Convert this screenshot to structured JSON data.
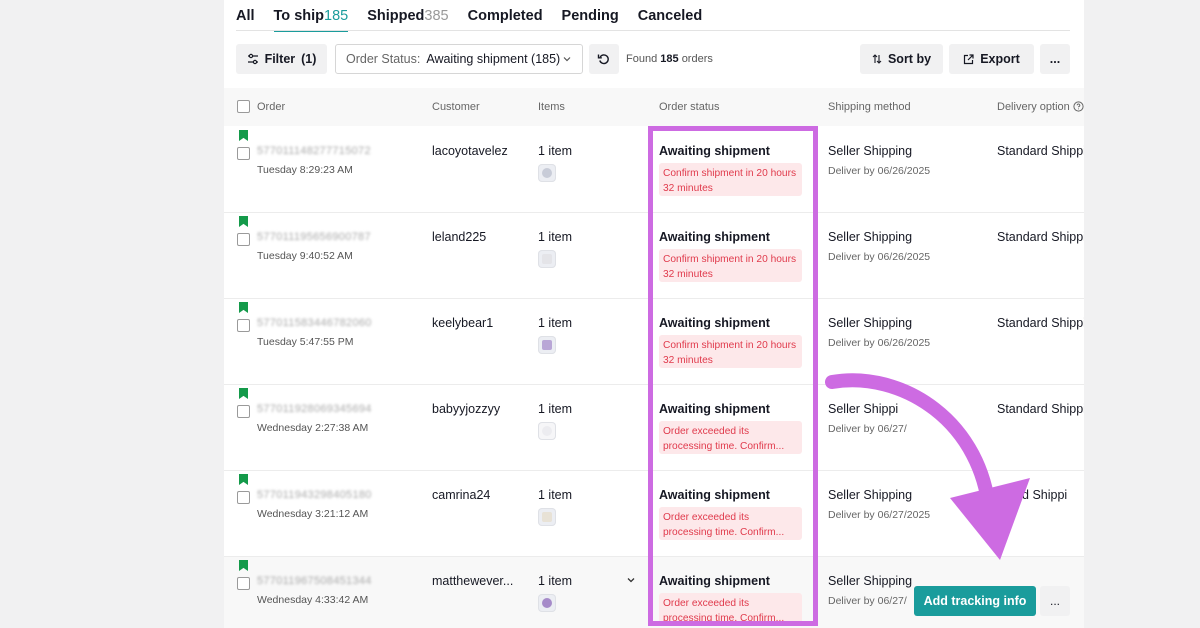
{
  "tabs": [
    {
      "label": "All",
      "count": ""
    },
    {
      "label": "To ship",
      "count": "185"
    },
    {
      "label": "Shipped",
      "count": "385"
    },
    {
      "label": "Completed",
      "count": ""
    },
    {
      "label": "Pending",
      "count": ""
    },
    {
      "label": "Canceled",
      "count": ""
    }
  ],
  "active_tab": "To ship",
  "toolbar": {
    "filter_label": "Filter",
    "filter_count": "(1)",
    "status_label": "Order Status:",
    "status_value": "Awaiting shipment (185)",
    "found_prefix": "Found",
    "found_count": "185",
    "found_suffix": "orders",
    "sort_label": "Sort by",
    "export_label": "Export",
    "more_label": "..."
  },
  "columns": {
    "order": "Order",
    "customer": "Customer",
    "items": "Items",
    "order_status": "Order status",
    "shipping_method": "Shipping method",
    "delivery_option": "Delivery option"
  },
  "rows": [
    {
      "order_id": "577011148277715072",
      "time": "Tuesday 8:29:23 AM",
      "customer": "lacoyotavelez",
      "items": "1 item",
      "status": "Awaiting shipment",
      "alert": "Confirm shipment in 20 hours 32 minutes",
      "shipping": "Seller Shipping",
      "deliver": "Deliver by 06/26/2025",
      "delivery_option": "Standard Shippi"
    },
    {
      "order_id": "577011195656900787",
      "time": "Tuesday 9:40:52 AM",
      "customer": "leland225",
      "items": "1 item",
      "status": "Awaiting shipment",
      "alert": "Confirm shipment in 20 hours 32 minutes",
      "shipping": "Seller Shipping",
      "deliver": "Deliver by 06/26/2025",
      "delivery_option": "Standard Shippi"
    },
    {
      "order_id": "577011583446782060",
      "time": "Tuesday 5:47:55 PM",
      "customer": "keelybear1",
      "items": "1 item",
      "status": "Awaiting shipment",
      "alert": "Confirm shipment in 20 hours 32 minutes",
      "shipping": "Seller Shipping",
      "deliver": "Deliver by 06/26/2025",
      "delivery_option": "Standard Shippi"
    },
    {
      "order_id": "577011928069345694",
      "time": "Wednesday 2:27:38 AM",
      "customer": "babyyjozzyy",
      "items": "1 item",
      "status": "Awaiting shipment",
      "alert": "Order exceeded its processing time. Confirm...",
      "shipping": "Seller Shippi",
      "deliver": "Deliver by 06/27/",
      "delivery_option": "Standard Shippi"
    },
    {
      "order_id": "577011943298405180",
      "time": "Wednesday 3:21:12 AM",
      "customer": "camrina24",
      "items": "1 item",
      "status": "Awaiting shipment",
      "alert": "Order exceeded its processing time. Confirm...",
      "shipping": "Seller Shipping",
      "deliver": "Deliver by 06/27/2025",
      "delivery_option": "ndard Shippi"
    },
    {
      "order_id": "577011967508451344",
      "time": "Wednesday 4:33:42 AM",
      "customer": "matthewever...",
      "items": "1 item",
      "status": "Awaiting shipment",
      "alert": "Order exceeded its processing time. Confirm...",
      "shipping": "Seller Shipping",
      "deliver": "Deliver by 06/27/",
      "delivery_option": ""
    }
  ],
  "row_actions": {
    "add_tracking_label": "Add tracking info",
    "more_label": "..."
  },
  "colors": {
    "accent": "#1a9c9c",
    "flag": "#149a4a",
    "alert_text": "#e03a4c",
    "alert_bg": "#fde8ea",
    "highlight": "#cd6be2"
  }
}
